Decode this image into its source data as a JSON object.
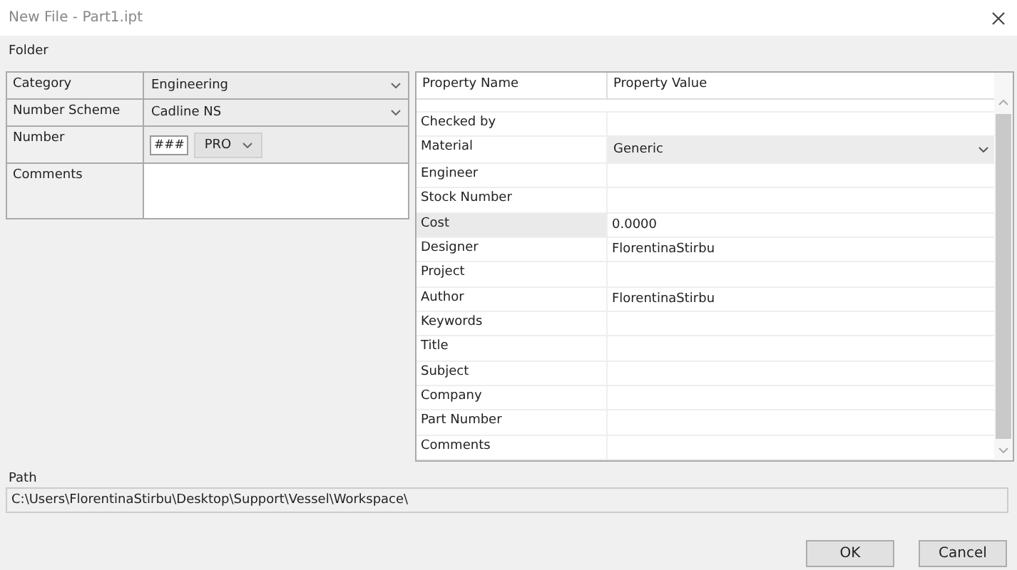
{
  "window": {
    "title": "New File - Part1.ipt"
  },
  "folder_label": "Folder",
  "fields": [
    {
      "label": "Category",
      "kind": "dropdown",
      "value": "Engineering"
    },
    {
      "label": "Number Scheme",
      "kind": "dropdown",
      "value": "Cadline NS"
    },
    {
      "label": "Number",
      "kind": "number",
      "prefix": "###",
      "value": "PRO"
    },
    {
      "label": "Comments",
      "kind": "textarea"
    }
  ],
  "properties": {
    "columns": [
      "Property Name",
      "Property Value"
    ],
    "rows": [
      {
        "name": "Checked by",
        "kind": "text",
        "highlighted": false
      },
      {
        "name": "Material",
        "value": "Generic",
        "kind": "dropdown",
        "highlighted": false
      },
      {
        "name": "Engineer",
        "kind": "text",
        "highlighted": false
      },
      {
        "name": "Stock Number",
        "kind": "text",
        "highlighted": false
      },
      {
        "name": "Cost",
        "value": "0.0000",
        "kind": "text",
        "highlighted": true
      },
      {
        "name": "Designer",
        "value": "FlorentinaStirbu",
        "kind": "text",
        "highlighted": false
      },
      {
        "name": "Project",
        "kind": "text",
        "highlighted": false
      },
      {
        "name": "Author",
        "value": "FlorentinaStirbu",
        "kind": "text",
        "highlighted": false
      },
      {
        "name": "Keywords",
        "kind": "text",
        "highlighted": false
      },
      {
        "name": "Title",
        "kind": "text",
        "highlighted": false
      },
      {
        "name": "Subject",
        "kind": "text",
        "highlighted": false
      },
      {
        "name": "Company",
        "kind": "text",
        "highlighted": false
      },
      {
        "name": "Part Number",
        "kind": "text",
        "highlighted": false
      },
      {
        "name": "Comments",
        "kind": "text",
        "highlighted": false
      }
    ]
  },
  "path": {
    "label": "Path",
    "value": "C:\\Users\\FlorentinaStirbu\\Desktop\\Support\\Vessel\\Workspace\\"
  },
  "buttons": [
    "OK",
    "Cancel"
  ]
}
